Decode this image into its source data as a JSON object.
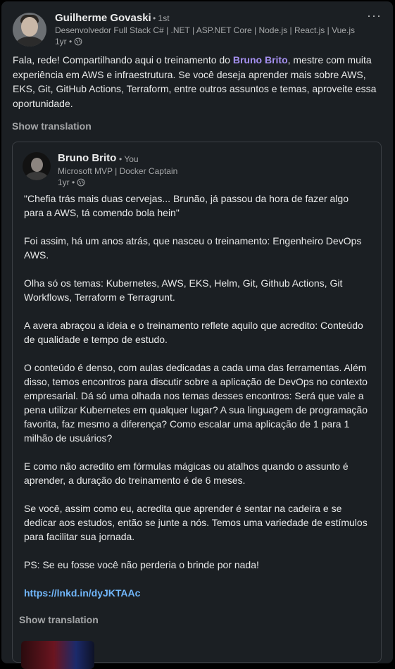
{
  "post": {
    "author_name": "Guilherme Govaski",
    "degree": "• 1st",
    "headline": "Desenvolvedor Full Stack C# | .NET | ASP.NET Core | Node.js | React.js | Vue.js",
    "time": "1yr •",
    "more_label": "···",
    "text_before": "Fala, rede! Compartilhando aqui o treinamento do ",
    "mention": "Bruno Brito",
    "text_after": ", mestre com muita experiência em AWS e infraestrutura. Se você deseja aprender mais sobre AWS, EKS, Git, GitHub Actions, Terraform, entre outros assuntos e temas, aproveite essa oportunidade.",
    "show_translation": "Show translation"
  },
  "reshare": {
    "author_name": "Bruno Brito",
    "degree": "• You",
    "headline": "Microsoft MVP | Docker Captain",
    "time": "1yr •",
    "paragraphs": [
      "\"Chefia trás mais duas cervejas... Brunão, já passou da hora de fazer algo para a AWS, tá comendo bola hein\"",
      "Foi assim, há um anos atrás, que nasceu o treinamento: Engenheiro DevOps AWS.",
      "Olha só os temas: Kubernetes, AWS, EKS, Helm, Git, Github Actions, Git Workflows, Terraform e Terragrunt.",
      "A avera abraçou a ideia e o treinamento reflete aquilo que acredito: Conteúdo de qualidade e tempo de estudo.",
      "O conteúdo é denso, com aulas dedicadas a cada uma das ferramentas. Além disso, temos encontros para discutir sobre a aplicação de DevOps no contexto empresarial. Dá só uma olhada nos temas desses encontros: Será que vale a pena utilizar Kubernetes em qualquer lugar? A sua linguagem de programação favorita, faz mesmo a diferença? Como escalar uma aplicação de 1 para 1 milhão de usuários?",
      "E como não acredito em fórmulas mágicas ou atalhos quando o assunto é aprender, a duração do treinamento é de 6 meses.",
      "Se você, assim como eu, acredita que aprender é sentar na cadeira e se dedicar aos estudos, então se junte a nós. Temos uma variedade de estímulos para facilitar sua jornada.",
      "PS: Se eu fosse você não perderia o brinde por nada!"
    ],
    "link": "https://lnkd.in/dyJKTAAc",
    "show_translation": "Show translation"
  },
  "icons": {
    "globe": "globe-icon",
    "more": "more-options-icon"
  },
  "colors": {
    "background": "#000000",
    "card": "#1b1f23",
    "mention": "#a590f0",
    "link": "#71b7fb"
  }
}
